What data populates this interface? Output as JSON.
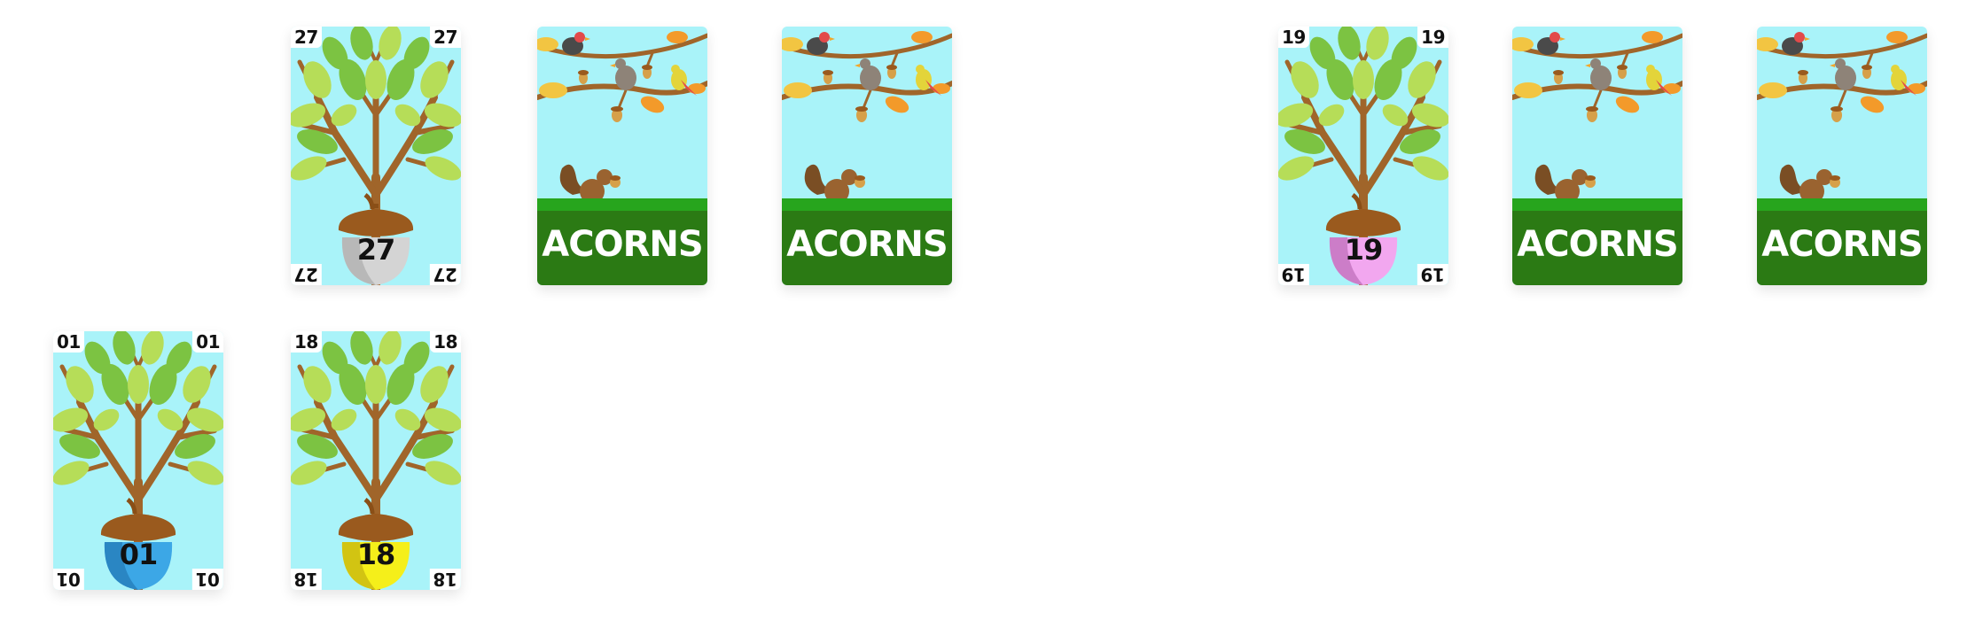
{
  "colors": {
    "sky": "#a9f3f9",
    "grass_band": "#27a51d",
    "field": "#2b7a14",
    "branch": "#a0652a",
    "leaf_dark": "#7cc342",
    "leaf_light": "#b6dd58",
    "acorn_cap": "#9a5a1e"
  },
  "card_back_label": "ACORNS",
  "face_cards": [
    {
      "number": "27",
      "nut_color": "#d4d4d4",
      "nut_shade": "#b8b8b8"
    },
    {
      "number": "19",
      "nut_color": "#f2a7ef",
      "nut_shade": "#cc7dc8"
    },
    {
      "number": "01",
      "nut_color": "#3ca7e6",
      "nut_shade": "#2a86c3"
    },
    {
      "number": "18",
      "nut_color": "#f5ef1a",
      "nut_shade": "#d2c412"
    }
  ],
  "back_cards": [
    {},
    {},
    {},
    {}
  ]
}
